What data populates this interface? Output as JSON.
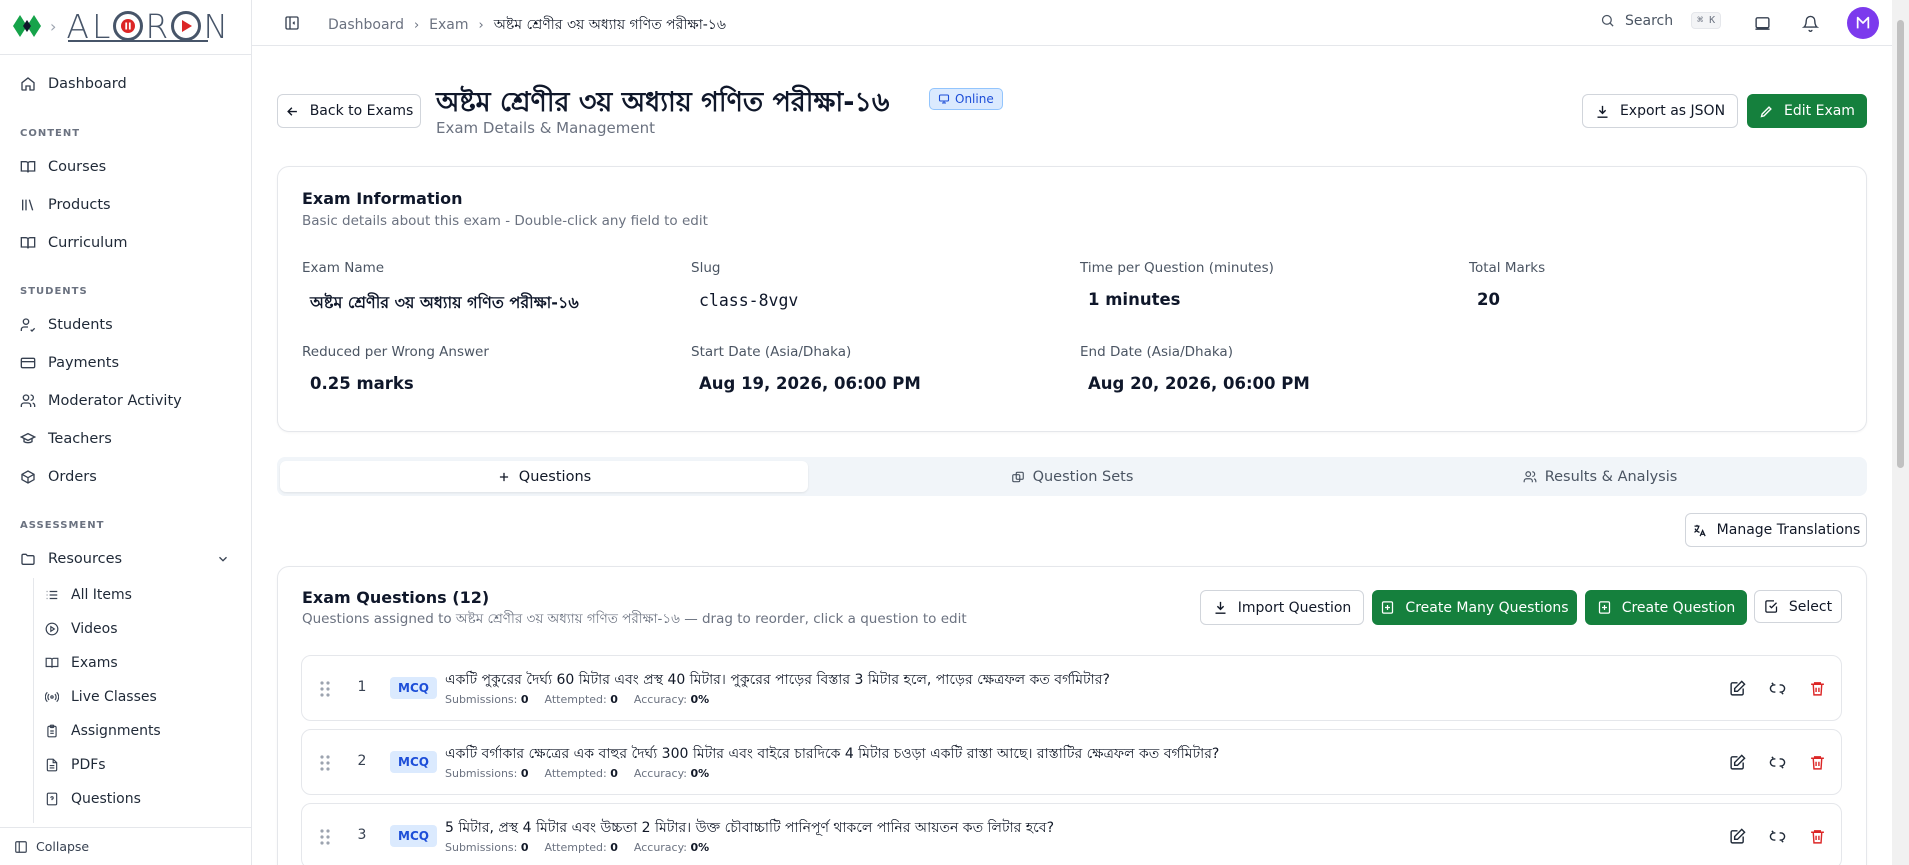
{
  "brand": {
    "logo_text": "ALORON"
  },
  "sidebar": {
    "dashboard": "Dashboard",
    "sections": {
      "content": "CONTENT",
      "students": "STUDENTS",
      "assessment": "ASSESSMENT"
    },
    "content_items": [
      "Courses",
      "Products",
      "Curriculum"
    ],
    "student_items": [
      "Students",
      "Payments",
      "Moderator Activity",
      "Teachers",
      "Orders"
    ],
    "resources": "Resources",
    "resource_items": [
      "All Items",
      "Videos",
      "Exams",
      "Live Classes",
      "Assignments",
      "PDFs",
      "Questions"
    ],
    "collapse": "Collapse"
  },
  "topbar": {
    "breadcrumb": [
      "Dashboard",
      "Exam",
      "অষ্টম শ্রেণীর ৩য় অধ্যায় গণিত পরীক্ষা-১৬"
    ],
    "search_label": "Search",
    "search_shortcut": "⌘ K",
    "avatar_initial": "M"
  },
  "header": {
    "back_label": "Back to Exams",
    "title": "অষ্টম শ্রেণীর ৩য় অধ্যায় গণিত পরীক্ষা-১৬",
    "status": "Online",
    "subtitle": "Exam Details & Management",
    "export_label": "Export as JSON",
    "edit_label": "Edit Exam"
  },
  "info": {
    "title": "Exam Information",
    "description": "Basic details about this exam - Double-click any field to edit",
    "fields": [
      {
        "label": "Exam Name",
        "value": "অষ্টম শ্রেণীর ৩য় অধ্যায় গণিত পরীক্ষা-১৬"
      },
      {
        "label": "Slug",
        "value": "class-8vgv"
      },
      {
        "label": "Time per Question (minutes)",
        "value": "1 minutes"
      },
      {
        "label": "Total Marks",
        "value": "20"
      },
      {
        "label": "Reduced per Wrong Answer",
        "value": "0.25 marks"
      },
      {
        "label": "Start Date (Asia/Dhaka)",
        "value": "Aug 19, 2026, 06:00 PM"
      },
      {
        "label": "End Date (Asia/Dhaka)",
        "value": "Aug 20, 2026, 06:00 PM"
      }
    ]
  },
  "tabs": [
    "Questions",
    "Question Sets",
    "Results & Analysis"
  ],
  "manage_translations": "Manage Translations",
  "questions": {
    "title": "Exam Questions (12)",
    "subtitle": "Questions assigned to অষ্টম শ্রেণীর ৩য় অধ্যায় গণিত পরীক্ষা-১৬ — drag to reorder, click a question to edit",
    "import_label": "Import Question",
    "create_many_label": "Create Many Questions",
    "create_label": "Create Question",
    "select_label": "Select",
    "stat_labels": {
      "submissions": "Submissions:",
      "attempted": "Attempted:",
      "accuracy": "Accuracy:"
    },
    "items": [
      {
        "num": "1",
        "type": "MCQ",
        "text": "একটি পুকুরের দৈর্ঘ্য 60 মিটার এবং প্রস্থ 40 মিটার। পুকুরের পাড়ের বিস্তার 3 মিটার হলে, পাড়ের ক্ষেত্রফল কত বর্গমিটার?",
        "submissions": "0",
        "attempted": "0",
        "accuracy": "0%"
      },
      {
        "num": "2",
        "type": "MCQ",
        "text": "একটি বর্গাকার ক্ষেত্রের এক বাহুর দৈর্ঘ্য 300 মিটার এবং বাইরে চারদিকে 4 মিটার চওড়া একটি রাস্তা আছে। রাস্তাটির ক্ষেত্রফল কত বর্গমিটার?",
        "submissions": "0",
        "attempted": "0",
        "accuracy": "0%"
      },
      {
        "num": "3",
        "type": "MCQ",
        "text": "5 মিটার, প্রস্থ 4 মিটার এবং উচ্চতা 2 মিটার। উক্ত চৌবাচ্চাটি পানিপূর্ণ থাকলে পানির আয়তন কত লিটার হবে?",
        "submissions": "0",
        "attempted": "0",
        "accuracy": "0%"
      }
    ]
  },
  "colors": {
    "primary_green": "#15803d",
    "accent_blue": "#1d4ed8",
    "danger": "#dc2626",
    "avatar": "#7c3aed"
  }
}
